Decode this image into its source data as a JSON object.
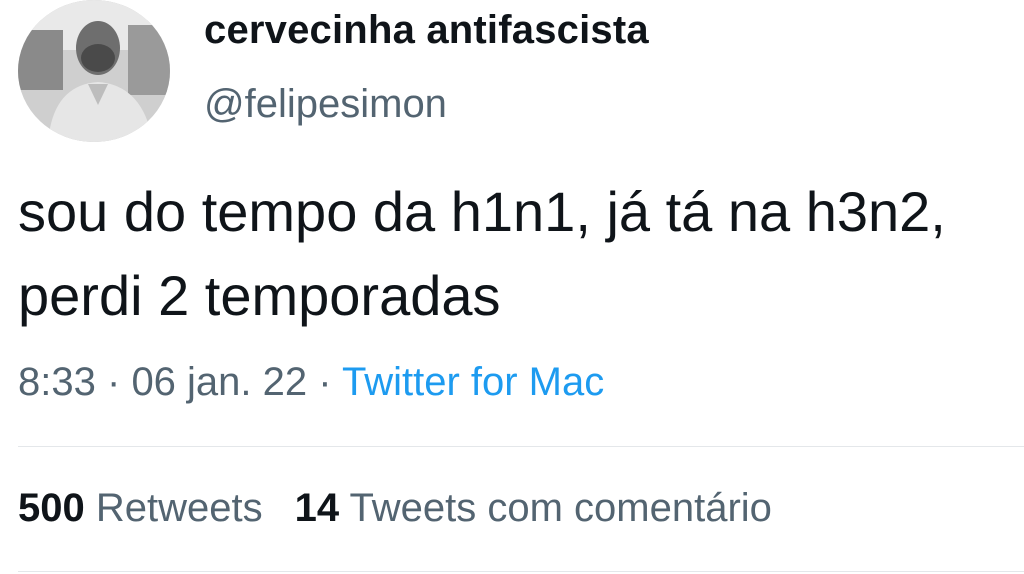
{
  "author": {
    "display_name": "cervecinha antifascista",
    "handle": "@felipesimon"
  },
  "tweet": {
    "text": "sou do tempo da h1n1, já tá na h3n2, perdi 2 temporadas",
    "time": "8:33",
    "separator": "·",
    "date": "06 jan. 22",
    "source": "Twitter for Mac"
  },
  "stats": {
    "retweets_count": "500",
    "retweets_label": "Retweets",
    "quotes_count": "14",
    "quotes_label": "Tweets com comentário"
  },
  "colors": {
    "text": "#0f1419",
    "secondary": "#536471",
    "link": "#1d9bf0"
  }
}
